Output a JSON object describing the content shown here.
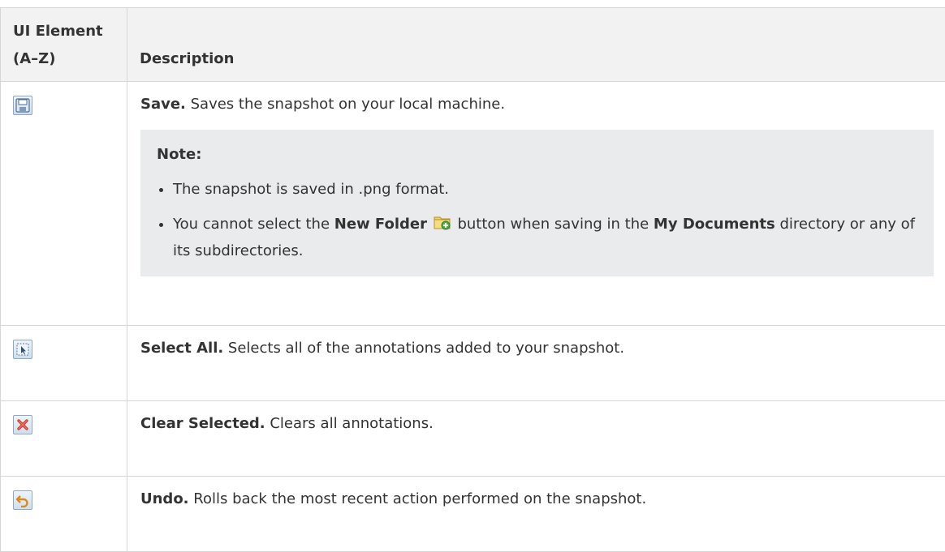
{
  "header": {
    "col1": "UI Element (A–Z)",
    "col2": "Description"
  },
  "rows": [
    {
      "icon": "save-icon",
      "name": "Save.",
      "text": " Saves the snapshot on your local machine.",
      "note": {
        "title": "Note:",
        "bullets": [
          {
            "text": "The snapshot is saved in .png format."
          },
          {
            "pre": "You cannot select the ",
            "bold1": "New Folder",
            "icon": "new-folder-icon",
            "mid": " button when saving in the ",
            "bold2": "My Documents",
            "post": " directory or any of its subdirectories."
          }
        ]
      }
    },
    {
      "icon": "select-all-icon",
      "name": "Select All.",
      "text": " Selects all of the annotations added to your snapshot."
    },
    {
      "icon": "clear-selected-icon",
      "name": "Clear Selected.",
      "text": " Clears all annotations."
    },
    {
      "icon": "undo-icon",
      "name": "Undo.",
      "text": " Rolls back the most recent action performed on the snapshot."
    }
  ]
}
